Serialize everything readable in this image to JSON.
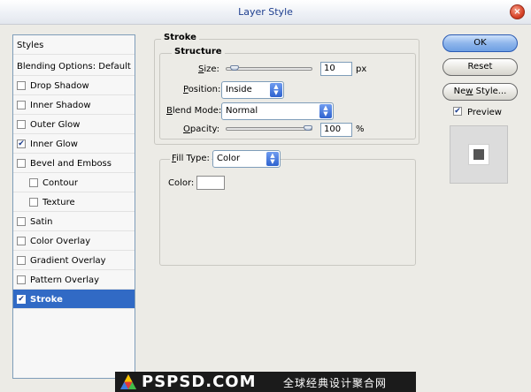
{
  "window": {
    "title": "Layer Style",
    "close_glyph": "×"
  },
  "styles_list": {
    "header": "Styles",
    "blending": "Blending Options: Default",
    "items": [
      {
        "label": "Drop Shadow",
        "checked": false,
        "indent": false,
        "selected": false
      },
      {
        "label": "Inner Shadow",
        "checked": false,
        "indent": false,
        "selected": false
      },
      {
        "label": "Outer Glow",
        "checked": false,
        "indent": false,
        "selected": false
      },
      {
        "label": "Inner Glow",
        "checked": true,
        "indent": false,
        "selected": false
      },
      {
        "label": "Bevel and Emboss",
        "checked": false,
        "indent": false,
        "selected": false
      },
      {
        "label": "Contour",
        "checked": false,
        "indent": true,
        "selected": false
      },
      {
        "label": "Texture",
        "checked": false,
        "indent": true,
        "selected": false
      },
      {
        "label": "Satin",
        "checked": false,
        "indent": false,
        "selected": false
      },
      {
        "label": "Color Overlay",
        "checked": false,
        "indent": false,
        "selected": false
      },
      {
        "label": "Gradient Overlay",
        "checked": false,
        "indent": false,
        "selected": false
      },
      {
        "label": "Pattern Overlay",
        "checked": false,
        "indent": false,
        "selected": false
      },
      {
        "label": "Stroke",
        "checked": true,
        "indent": false,
        "selected": true
      }
    ],
    "check_glyph": "✔"
  },
  "stroke": {
    "title": "Stroke",
    "structure": {
      "title": "Structure",
      "size": {
        "label": "Size:",
        "value": "10",
        "unit": "px",
        "level": 0.06
      },
      "position": {
        "label": "Position:",
        "value": "Inside"
      },
      "blend_mode": {
        "label": "Blend Mode:",
        "value": "Normal"
      },
      "opacity": {
        "label": "Opacity:",
        "value": "100",
        "unit": "%",
        "level": 1.0
      }
    },
    "fill": {
      "label": "Fill Type:",
      "value": "Color",
      "color_label": "Color:",
      "color_value": "#ffffff"
    }
  },
  "buttons": {
    "ok": "OK",
    "reset": "Reset",
    "new_style": "New Style...",
    "preview": "Preview",
    "preview_checked": true
  },
  "select_arrow": {
    "up": "▲",
    "down": "▼"
  },
  "watermark": {
    "brand": "PSPSD.COM",
    "tagline": "全球经典设计聚合网"
  },
  "colors": {
    "accent": "#316ac5",
    "title_text": "#1f3f8f",
    "panel_bg": "#ecebe6"
  }
}
